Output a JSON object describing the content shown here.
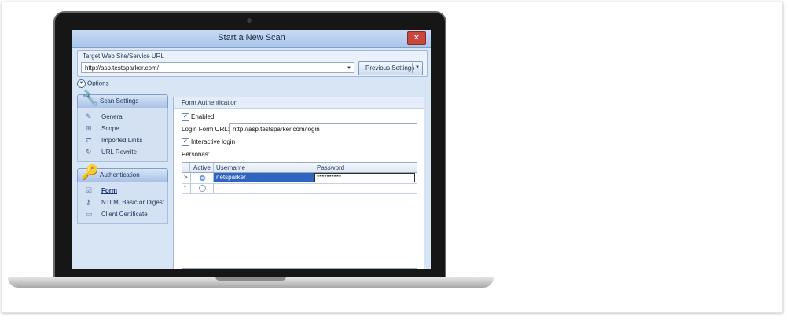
{
  "window": {
    "title": "Start a New Scan",
    "close_glyph": "✕"
  },
  "target": {
    "label": "Target Web Site/Service URL",
    "url": "http://asp.testsparker.com/",
    "previous_settings": "Previous Settings"
  },
  "options": {
    "label": "Options"
  },
  "scan_settings": {
    "header": "Scan Settings",
    "items": [
      {
        "label": "General",
        "icon": "wrench-icon"
      },
      {
        "label": "Scope",
        "icon": "sitemap-icon"
      },
      {
        "label": "Imported Links",
        "icon": "links-icon"
      },
      {
        "label": "URL Rewrite",
        "icon": "rewrite-icon"
      }
    ]
  },
  "authentication": {
    "header": "Authentication",
    "items": [
      {
        "label": "Form",
        "icon": "form-icon",
        "active": true
      },
      {
        "label": "NTLM, Basic or Digest",
        "icon": "key-icon"
      },
      {
        "label": "Client Certificate",
        "icon": "certificate-icon"
      }
    ]
  },
  "form_auth": {
    "header": "Form Authentication",
    "enabled_label": "Enabled",
    "enabled": true,
    "login_url_label": "Login Form URL:",
    "login_url": "http://asp.testsparker.com/login",
    "interactive_label": "Interactive login",
    "interactive": true,
    "personas_label": "Personas:",
    "columns": [
      "Active",
      "Username",
      "Password"
    ],
    "rows": [
      {
        "marker": ">",
        "active": true,
        "username": "netsparker",
        "password": "**********"
      },
      {
        "marker": "*",
        "active": false,
        "username": "",
        "password": ""
      }
    ]
  },
  "colors": {
    "accent": "#2f65c2",
    "panel": "#d7e5f5",
    "close": "#c9473c"
  }
}
